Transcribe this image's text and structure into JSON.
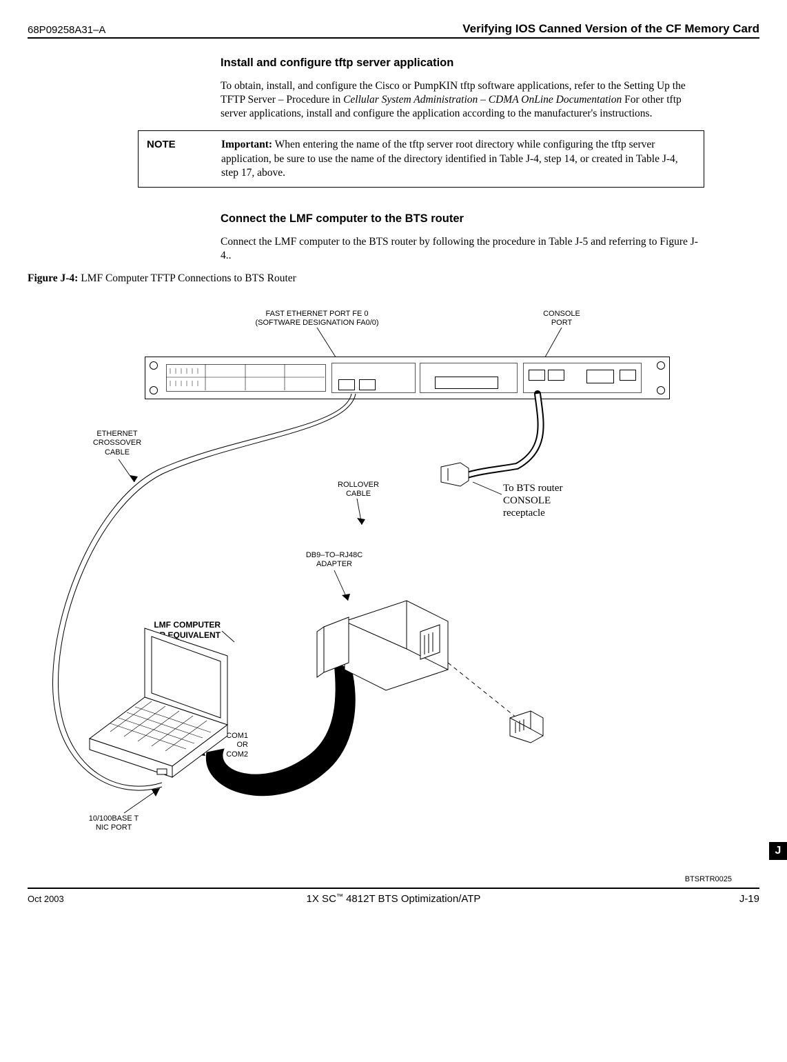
{
  "header": {
    "docnum": "68P09258A31–A",
    "title": "Verifying IOS Canned Version of the CF Memory Card"
  },
  "section1": {
    "heading": "Install and configure tftp server application",
    "para_prefix": "To obtain, install, and configure the Cisco or PumpKIN tftp software applications, refer to the Setting Up the TFTP Server – Procedure in ",
    "para_italic": "Cellular System Administration – CDMA OnLine Documentation",
    "para_suffix": " For other tftp server applications, install and configure the application according to the manufacturer's instructions."
  },
  "note": {
    "label": "NOTE",
    "important": "Important:",
    "body": " When entering the name of the tftp server root directory while configuring the tftp server application, be sure to use the name of the directory identified in Table J-4, step 14, or created in Table J-4, step 17, above."
  },
  "section2": {
    "heading": "Connect the LMF computer to the BTS router",
    "para": "Connect the LMF computer to the BTS router by following the procedure in Table J-5 and referring to Figure J-4.."
  },
  "figure": {
    "caption_bold": "Figure J-4:",
    "caption_rest": "  LMF Computer TFTP Connections to BTS Router",
    "labels": {
      "fe0_line1": "FAST ETHERNET PORT FE 0",
      "fe0_line2": "(SOFTWARE DESIGNATION FA0/0)",
      "console_port": "CONSOLE\nPORT",
      "eth_xover": "ETHERNET\nCROSSOVER\nCABLE",
      "rollover": "ROLLOVER\nCABLE",
      "to_bts": "To BTS router\nCONSOLE\nreceptacle",
      "db9": "DB9–TO–RJ48C\nADAPTER",
      "lmf": "LMF COMPUTER\nOR EQUIVALENT",
      "com": "COM1\nOR\nCOM2",
      "nic": "10/100BASE T\nNIC PORT"
    },
    "ref": "BTSRTR0025"
  },
  "footer": {
    "left": "Oct 2003",
    "center_pre": "1X SC",
    "center_tm": "™",
    "center_post": " 4812T BTS Optimization/ATP",
    "right": "J-19",
    "tab": "J"
  }
}
